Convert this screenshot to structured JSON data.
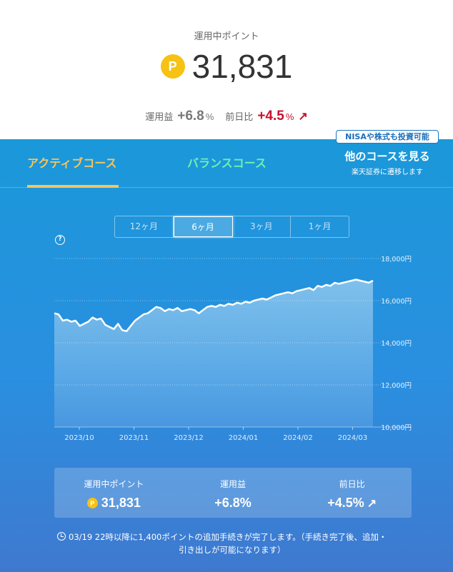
{
  "header": {
    "label": "運用中ポイント",
    "coin_symbol": "P",
    "points": "31,831",
    "profit_label": "運用益",
    "profit_value": "+6.8",
    "profit_unit": "%",
    "daily_label": "前日比",
    "daily_value": "+4.5",
    "daily_unit": "%",
    "daily_arrow": "↗"
  },
  "tabs": {
    "active": "アクティブコース",
    "balance": "バランスコース",
    "nisa_badge": "NISAや株式も投資可能",
    "other": "他のコースを見る",
    "other_sub": "楽天証券に遷移します"
  },
  "periods": [
    "12ヶ月",
    "6ヶ月",
    "3ヶ月",
    "1ヶ月"
  ],
  "selected_period": "6ヶ月",
  "help_icon": "?",
  "chart_data": {
    "type": "area",
    "x_labels": [
      "2023/10",
      "2023/11",
      "2023/12",
      "2024/01",
      "2024/02",
      "2024/03"
    ],
    "y_ticks": [
      "18,000円",
      "16,000円",
      "14,000円",
      "12,000円",
      "10,000円"
    ],
    "ylim": [
      10000,
      18000
    ],
    "grid": true,
    "values": [
      15400,
      15350,
      15050,
      15100,
      15000,
      15050,
      14800,
      14900,
      15000,
      15200,
      15100,
      15150,
      14850,
      14750,
      14650,
      14900,
      14600,
      14550,
      14800,
      15050,
      15200,
      15350,
      15400,
      15550,
      15700,
      15650,
      15500,
      15600,
      15550,
      15650,
      15500,
      15550,
      15600,
      15550,
      15400,
      15550,
      15700,
      15750,
      15700,
      15800,
      15750,
      15850,
      15800,
      15900,
      15850,
      15950,
      15900,
      16000,
      16050,
      16100,
      16050,
      16150,
      16250,
      16300,
      16350,
      16400,
      16350,
      16450,
      16500,
      16550,
      16600,
      16500,
      16700,
      16650,
      16750,
      16700,
      16850,
      16800,
      16850,
      16900,
      16950,
      17000,
      16950,
      16900,
      16850,
      16950
    ]
  },
  "summary": {
    "points_label": "運用中ポイント",
    "points": "31,831",
    "profit_label": "運用益",
    "profit": "+6.8%",
    "daily_label": "前日比",
    "daily": "+4.5%",
    "arrow": "↗"
  },
  "notice": {
    "line1": "03/19 22時以降に1,400ポイントの追加手続きが完了します。（手続き完了後、追加・",
    "line2": "引き出しが可能になります）"
  }
}
